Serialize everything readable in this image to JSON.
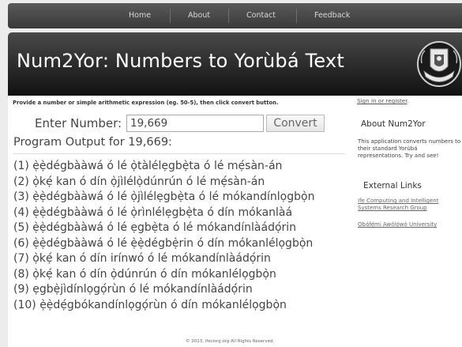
{
  "nav": {
    "items": [
      "Home",
      "About",
      "Contact",
      "Feedback"
    ]
  },
  "header": {
    "title": "Num2Yor: Numbers to Yorùbá Text",
    "logo_icon": "university-crest-icon"
  },
  "form": {
    "instructions": "Provide a number or simple arithmetic expression (eg. 50-5), then click convert button.",
    "enter_label": "Enter Number:",
    "input_value": "19,669",
    "convert_label": "Convert"
  },
  "output": {
    "title": "Program Output for 19,669:",
    "results": [
      "(1) ẹ̀ẹ̀dégbààwá ó lé ọ̀tàlélẹgbẹ̀ta ó lé mẹ́sàn-án",
      "(2) ọ̀kẹ́ kan ó dín ọ̀jìlélọ̀dúnrún ó lé mẹ́sàn-án",
      "(3) ẹ̀ẹ̀dégbààwá ó lé ọ̀jìlélẹgbẹ̀ta ó lé mókandínlọgbọ̀n",
      "(4) ẹ̀ẹ̀dégbààwá ó lé ọ̀rìnlélẹgbẹ̀ta ó dín mókanlàá",
      "(5) ẹ̀ẹ̀dégbààwá ó lé ẹgbẹ̀ta ó lé mókandínlàádọ́rin",
      "(6) ẹ̀ẹ̀dégbààwá ó lé ẹ̀ẹ̀dégbẹ̀rin ó dín mókanlélọgbọ̀n",
      "(7) ọ̀kẹ́ kan ó dín irínwó ó lé mókandínlàádọ́rin",
      "(8) ọ̀kẹ́ kan ó dín ọ̀dúnrún ó dín mókanlélọgbọ̀n",
      "(9) ẹgbẹ̀jìdínlọgọ́rùn ó lé mókandínlàádọ́rin",
      "(10) ẹ̀ẹ̀dẹ́gbókandínlọgọ́rùn ó dín mókanlélọgbọ̀n"
    ]
  },
  "sidebar": {
    "signin_link": "Sign in or register",
    "signin_suffix": ".",
    "about_title": "About Num2Yor",
    "about_text": "This application converts numbers to their standard Yorùbá representations. Try and see!",
    "links_title": "External Links",
    "links": [
      "Ife Computing and Intelligent Systems Research Group",
      "Ọbáfẹ́mi Awólọ́wọ̀ University"
    ]
  },
  "footer": {
    "text": "© 2013, ifecisrg.org All Rights Reserved."
  },
  "colors": {
    "header_dark": "#2a2a2a",
    "nav_bg": "#4a4a4a",
    "page_bg": "#ececec"
  }
}
